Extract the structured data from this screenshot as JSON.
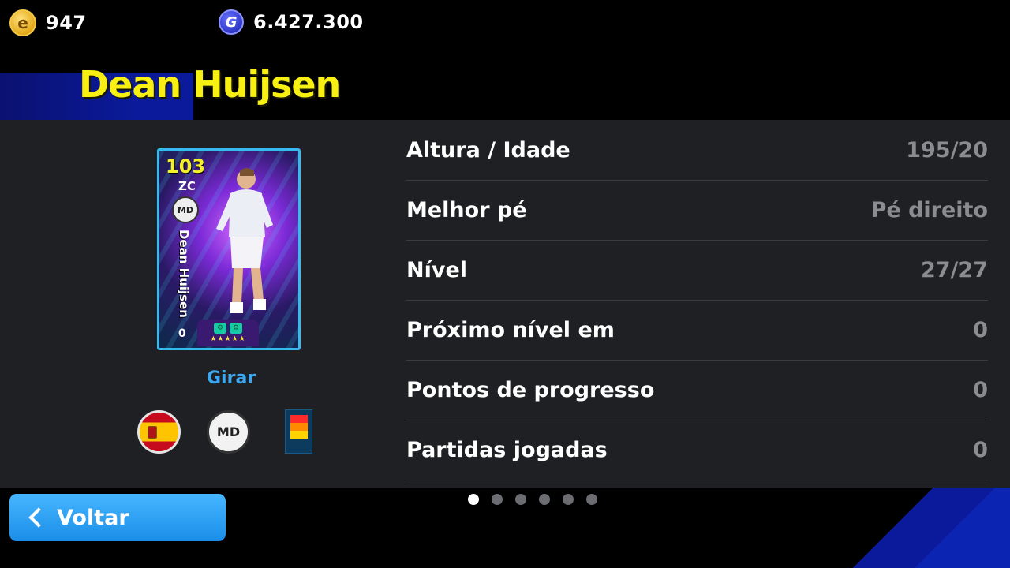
{
  "currency": {
    "coins_value": "947",
    "gp_value": "6.427.300"
  },
  "player": {
    "name": "Dean Huijsen",
    "card": {
      "rating": "103",
      "position": "ZC",
      "club_short": "MD",
      "vertical_name": "Dean Huijsen",
      "side_number": "0",
      "stars": "★★★★★"
    }
  },
  "rotate_label": "Girar",
  "details": [
    {
      "label": "Altura / Idade",
      "value": "195/20"
    },
    {
      "label": "Melhor pé",
      "value": "Pé direito"
    },
    {
      "label": "Nível",
      "value": "27/27"
    },
    {
      "label": "Próximo nível em",
      "value": "0"
    },
    {
      "label": "Pontos de progresso",
      "value": "0"
    },
    {
      "label": "Partidas jogadas",
      "value": "0"
    }
  ],
  "pagination": {
    "total": 6,
    "active": 1
  },
  "back_button": {
    "label": "Voltar"
  },
  "colors": {
    "accent": "#1a8ee8",
    "name": "#f7f012",
    "panel": "#1e2024"
  }
}
